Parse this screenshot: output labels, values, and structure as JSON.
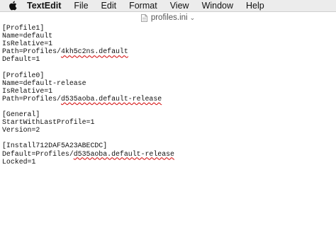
{
  "menubar": {
    "apple_icon": "apple-logo-icon",
    "app_name": "TextEdit",
    "items": [
      "File",
      "Edit",
      "Format",
      "View",
      "Window",
      "Help"
    ]
  },
  "document": {
    "title": "profiles.ini",
    "title_icon": "text-document-icon",
    "title_chevron": "⌄"
  },
  "editor": {
    "lines": [
      {
        "pre": "[Profile1]"
      },
      {
        "pre": "Name=default"
      },
      {
        "pre": "IsRelative=1"
      },
      {
        "pre": "Path=Profiles/",
        "misspelled": "4kh5c2ns.default"
      },
      {
        "pre": "Default=1"
      },
      {
        "pre": ""
      },
      {
        "pre": "[Profile0]"
      },
      {
        "pre": "Name=default-release"
      },
      {
        "pre": "IsRelative=1"
      },
      {
        "pre": "Path=Profiles/",
        "misspelled": "d535aoba.default-release"
      },
      {
        "pre": ""
      },
      {
        "pre": "[General]"
      },
      {
        "pre": "StartWithLastProfile=1"
      },
      {
        "pre": "Version=2"
      },
      {
        "pre": ""
      },
      {
        "pre": "[Install712DAF5A23ABECDC]"
      },
      {
        "pre": "Default=Profiles/",
        "misspelled": "d535aoba.default-release"
      },
      {
        "pre": "Locked=1"
      }
    ]
  }
}
